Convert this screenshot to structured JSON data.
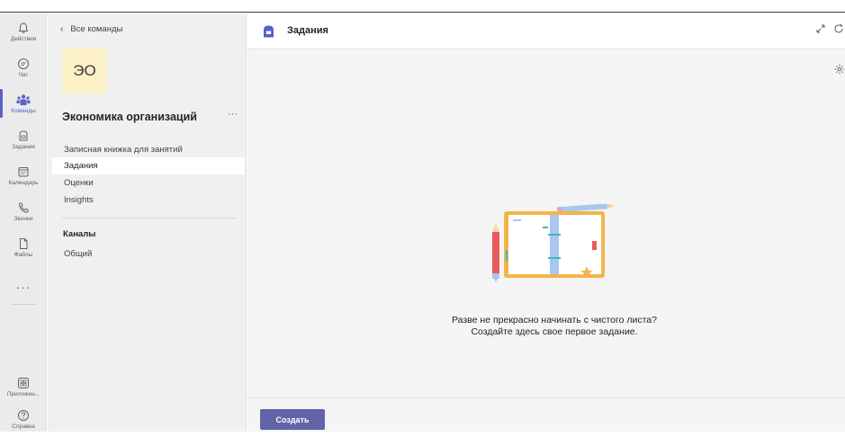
{
  "rail": {
    "items": [
      {
        "label": "Действия",
        "icon": "bell-icon"
      },
      {
        "label": "Чат",
        "icon": "chat-icon"
      },
      {
        "label": "Команды",
        "icon": "teams-icon",
        "active": true
      },
      {
        "label": "Задания",
        "icon": "assignments-icon"
      },
      {
        "label": "Календарь",
        "icon": "calendar-icon"
      },
      {
        "label": "Звонки",
        "icon": "phone-icon"
      },
      {
        "label": "Файлы",
        "icon": "file-icon"
      }
    ],
    "more": "···",
    "apps_label": "Приложен...",
    "help_label": "Справка"
  },
  "sidebar": {
    "back_label": "Все команды",
    "team_initials": "ЭО",
    "team_name": "Экономика организаций",
    "team_more": "···",
    "nav": [
      {
        "label": "Записная книжка для занятий"
      },
      {
        "label": "Задания",
        "active": true
      },
      {
        "label": "Оценки"
      },
      {
        "label": "Insights"
      }
    ],
    "channels_heading": "Каналы",
    "channels": [
      {
        "label": "Общий"
      }
    ]
  },
  "main": {
    "title": "Задания",
    "empty_message": "Разве не прекрасно начинать с чистого листа? Создайте здесь свое первое задание.",
    "create_label": "Создать"
  },
  "colors": {
    "accent": "#6264a7",
    "team_avatar_bg": "#fcf0c6",
    "rail_bg": "#ebebeb",
    "sidebar_bg": "#f0f0f0"
  }
}
